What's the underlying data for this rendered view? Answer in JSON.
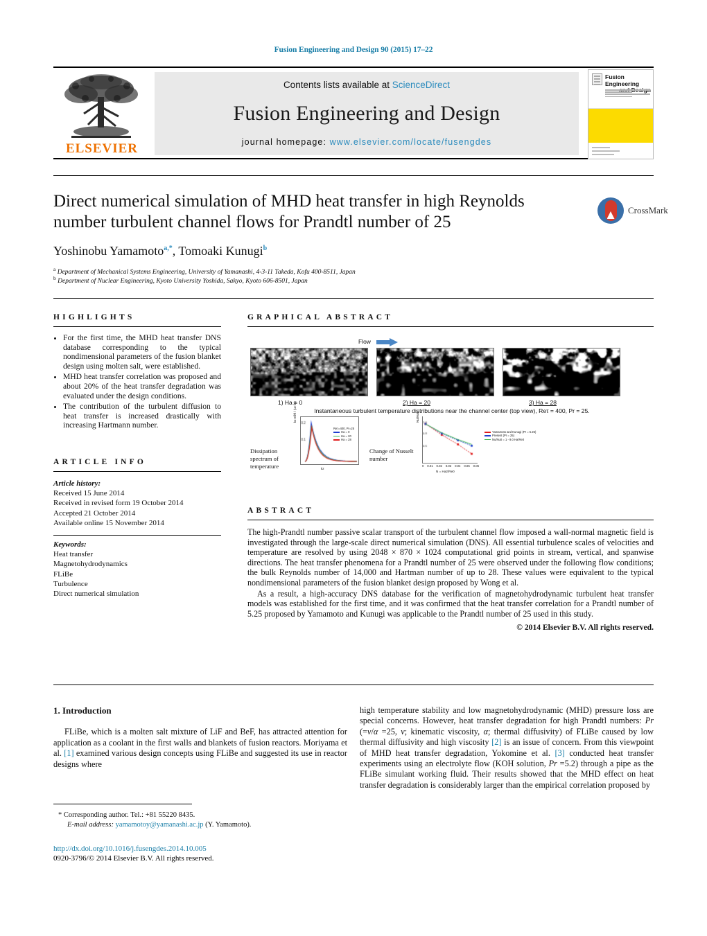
{
  "running_head": "Fusion Engineering and Design 90 (2015) 17–22",
  "masthead": {
    "contents_prefix": "Contents lists available at ",
    "contents_link": "ScienceDirect",
    "journal_title": "Fusion Engineering and Design",
    "homepage_label": "journal homepage: ",
    "homepage_url": "www.elsevier.com/locate/fusengdes",
    "publisher": "ELSEVIER",
    "cover": {
      "title_line1": "Fusion Engineering",
      "title_line2": "and Design"
    }
  },
  "article": {
    "title": "Direct numerical simulation of MHD heat transfer in high Reynolds number turbulent channel flows for Prandtl number of 25",
    "crossmark_label": "CrossMark",
    "authors_html": "Yoshinobu Yamamoto<sup>a,*</sup>, Tomoaki Kunugi<sup>b</sup>",
    "affiliation_a": "Department of Mechanical Systems Engineering, University of Yamanashi, 4-3-11 Takeda, Kofu 400-8511, Japan",
    "affiliation_b": "Department of Nuclear Engineering, Kyoto University Yoshida, Sakyo, Kyoto 606-8501, Japan"
  },
  "highlights": {
    "heading": "Highlights",
    "items": [
      "For the first time, the MHD heat transfer DNS database corresponding to the typical nondimensional parameters of the fusion blanket design using molten salt, were established.",
      "MHD heat transfer correlation was proposed and about 20% of the heat transfer degradation was evaluated under the design conditions.",
      "The contribution of the turbulent diffusion to heat transfer is increased drastically with increasing Hartmann number."
    ]
  },
  "graphical_abstract": {
    "heading": "Graphical abstract",
    "flow_label": "Flow",
    "panel_captions": [
      "1) Ha = 0",
      "2) Ha = 20",
      "3) Ha = 28"
    ],
    "figure_caption": "Instantaneous turbulent temperature distributions near the channel center (top view), Reτ = 400, Pr = 25.",
    "left_chart_label": "Dissipation spectrum of temperature",
    "right_chart_label": "Change of Nusselt number",
    "left_legend_title": "Reτ=400, Pr=25",
    "left_legend": [
      "Ha = 0",
      "Ha = 20",
      "Ha = 28"
    ],
    "right_legend": [
      "Yamamoto and Kunugi (Pr = 5.25)",
      "Present (Pr = 25)",
      "Nu/Nu0 = 1 - 9.0 Ha/Re0"
    ],
    "left_y_axis": "kz Eθθ / (uτ θτ)",
    "left_x_axis": "kz",
    "right_y_axis": "Nu/Nu0",
    "right_x_axis": "N = Ha2/Re0",
    "right_x_ticks": [
      "0",
      "0.01",
      "0.02",
      "0.03",
      "0.04",
      "0.05",
      "0.06"
    ]
  },
  "chart_data": [
    {
      "type": "line",
      "title": "Dissipation spectrum of temperature",
      "xlabel": "kz",
      "ylabel": "kz Eθθ / (uτ θτ)",
      "ytick_labels": [
        "0.1",
        "0.2"
      ],
      "xtick_labels": [
        "0.1",
        "1"
      ],
      "series": [
        {
          "name": "Ha = 0",
          "color": "#1f3fd0"
        },
        {
          "name": "Ha = 20",
          "color": "#37b34a"
        },
        {
          "name": "Ha = 28",
          "color": "#e01b1b"
        }
      ]
    },
    {
      "type": "line",
      "title": "Change of Nusselt number",
      "xlabel": "N = Ha2/Re0",
      "ylabel": "Nu/Nu0",
      "x": [
        0,
        0.02,
        0.04,
        0.057
      ],
      "series": [
        {
          "name": "Yamamoto and Kunugi (Pr = 5.25)",
          "color": "#e01b1b",
          "values": [
            1.0,
            0.84,
            0.7,
            0.56
          ]
        },
        {
          "name": "Present (Pr = 25)",
          "color": "#1f3fd0",
          "values": [
            1.0,
            0.86,
            0.76,
            0.68
          ]
        },
        {
          "name": "Nu/Nu0 = 1 - 9.0 Ha/Re0",
          "color": "#37b34a",
          "values": [
            1.0,
            0.87,
            0.77,
            0.7
          ]
        }
      ],
      "xlim": [
        0,
        0.06
      ],
      "ylim": [
        0.5,
        1.05
      ]
    }
  ],
  "article_info": {
    "heading": "Article info",
    "history_label": "Article history:",
    "history": [
      "Received 15 June 2014",
      "Received in revised form 19 October 2014",
      "Accepted 21 October 2014",
      "Available online 15 November 2014"
    ],
    "keywords_label": "Keywords:",
    "keywords": [
      "Heat transfer",
      "Magnetohydrodynamics",
      "FLiBe",
      "Turbulence",
      "Direct numerical simulation"
    ]
  },
  "abstract": {
    "heading": "Abstract",
    "paragraph1": "The high-Prandtl number passive scalar transport of the turbulent channel flow imposed a wall-normal magnetic field is investigated through the large-scale direct numerical simulation (DNS). All essential turbulence scales of velocities and temperature are resolved by using 2048 × 870 × 1024 computational grid points in stream, vertical, and spanwise directions. The heat transfer phenomena for a Prandtl number of 25 were observed under the following flow conditions; the bulk Reynolds number of 14,000 and Hartman number of up to 28. These values were equivalent to the typical nondimensional parameters of the fusion blanket design proposed by Wong et al.",
    "paragraph2": "As a result, a high-accuracy DNS database for the verification of magnetohydrodynamic turbulent heat transfer models was established for the first time, and it was confirmed that the heat transfer correlation for a Prandtl number of 5.25 proposed by Yamamoto and Kunugi was applicable to the Prandtl number of 25 used in this study.",
    "copyright": "© 2014 Elsevier B.V. All rights reserved."
  },
  "introduction": {
    "heading": "1. Introduction",
    "left_html": "FLiBe, which is a molten salt mixture of LiF and BeF, has attracted attention for application as a coolant in the first walls and blankets of fusion reactors. Moriyama et al. <span class=\"ref\">[1]</span> examined various design concepts using FLiBe and suggested its use in reactor designs where",
    "right_html": "high temperature stability and low magnetohydrodynamic (MHD) pressure loss are special concerns. However, heat transfer degradation for high Prandtl numbers: <em>Pr</em> (=<em>ν</em>/<em>α</em> =25, <em>ν</em>; kinematic viscosity, <em>α</em>; thermal diffusivity) of FLiBe caused by low thermal diffusivity and high viscosity <span class=\"ref\">[2]</span> is an issue of concern. From this viewpoint of MHD heat transfer degradation, Yokomine et al. <span class=\"ref\">[3]</span> conducted heat transfer experiments using an electrolyte flow (KOH solution, <em>Pr</em> =5.2) through a pipe as the FLiBe simulant working fluid. Their results showed that the MHD effect on heat transfer degradation is considerably larger than the empirical correlation proposed by"
  },
  "footer": {
    "corresponding_marker": "*",
    "corresponding_text": "Corresponding author. Tel.: +81 55220 8435.",
    "email_label": "E-mail address:",
    "email": "yamamotoy@yamanashi.ac.jp",
    "email_suffix": "(Y. Yamamoto).",
    "doi": "http://dx.doi.org/10.1016/j.fusengdes.2014.10.005",
    "issn_line": "0920-3796/© 2014 Elsevier B.V. All rights reserved."
  },
  "colors": {
    "link": "#1b7fa8",
    "elsevier_orange": "#ee7203",
    "cover_yellow": "#fcdb00",
    "arrow_blue": "#4a86c5"
  }
}
